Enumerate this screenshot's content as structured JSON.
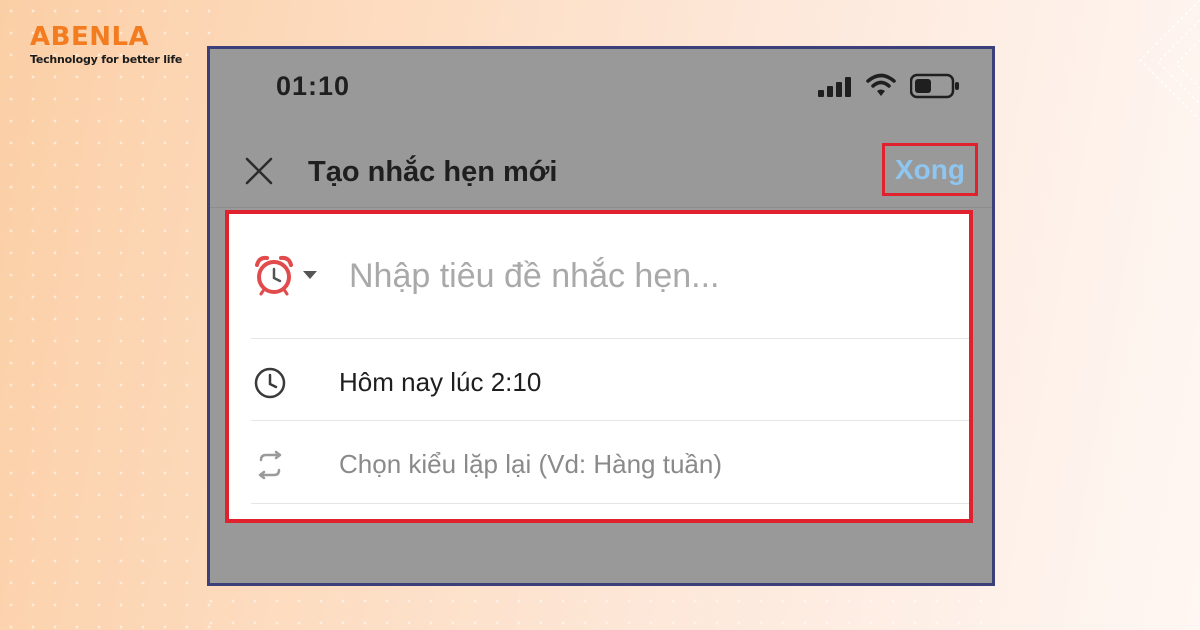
{
  "brand": {
    "name": "ABENLA",
    "tagline": "Technology for better life",
    "accent_color": "#f47c20"
  },
  "status_bar": {
    "time": "01:10",
    "icons": [
      "signal-icon",
      "wifi-icon",
      "battery-icon"
    ]
  },
  "header": {
    "close_icon": "close-icon",
    "title": "Tạo nhắc hẹn mới",
    "done_label": "Xong",
    "highlight_color": "#e0212e"
  },
  "form": {
    "title_input": {
      "value": "",
      "placeholder": "Nhập tiêu đề nhắc hẹn...",
      "icon": "alarm-clock-icon"
    },
    "time_row": {
      "icon": "clock-icon",
      "label": "Hôm nay lúc 2:10"
    },
    "repeat_row": {
      "icon": "repeat-icon",
      "label": "Chọn kiểu lặp lại (Vd: Hàng tuần)"
    }
  }
}
